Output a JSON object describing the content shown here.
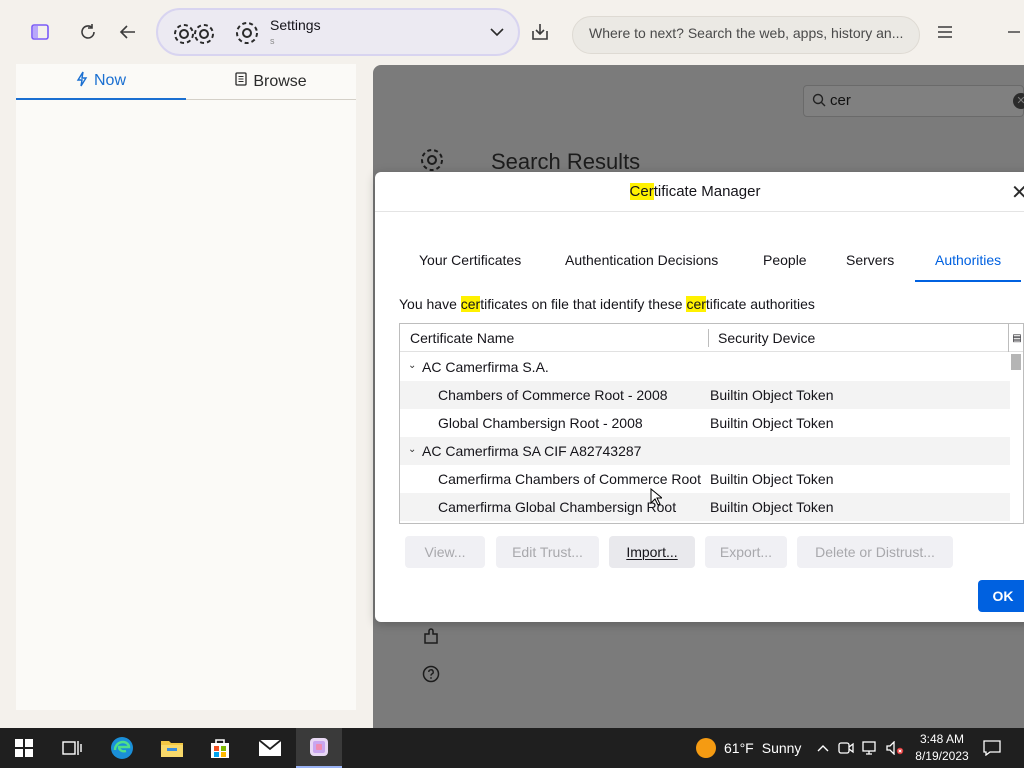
{
  "browser": {
    "url_title": "Settings",
    "url_subtitle": "s",
    "search_placeholder": "Where to next? Search the web, apps, history an..."
  },
  "sidebar": {
    "tabs": [
      {
        "label": "Now",
        "icon": "lightning-icon",
        "active": true
      },
      {
        "label": "Browse",
        "icon": "book-icon",
        "active": false
      }
    ]
  },
  "settings": {
    "find_value": "cer",
    "results_title": "Search Results"
  },
  "dialog": {
    "title_highlight": "Cer",
    "title_rest": "tificate Manager",
    "tabs": [
      {
        "label": "Your Certificates",
        "active": false
      },
      {
        "label": "Authentication Decisions",
        "active": false
      },
      {
        "label": "People",
        "active": false
      },
      {
        "label": "Servers",
        "active": false
      },
      {
        "label": "Authorities",
        "active": true
      }
    ],
    "desc_parts": [
      "You have ",
      "cer",
      "tificates on file that identify these ",
      "cer",
      "tificate authorities"
    ],
    "columns": [
      "Certificate Name",
      "Security Device"
    ],
    "rows": [
      {
        "type": "group",
        "name": "AC Camerfirma S.A.",
        "device": ""
      },
      {
        "type": "cert",
        "name": "Chambers of Commerce Root - 2008",
        "device": "Builtin Object Token"
      },
      {
        "type": "cert",
        "name": "Global Chambersign Root - 2008",
        "device": "Builtin Object Token"
      },
      {
        "type": "group",
        "name": "AC Camerfirma SA CIF A82743287",
        "device": ""
      },
      {
        "type": "cert",
        "name": "Camerfirma Chambers of Commerce Root",
        "device": "Builtin Object Token"
      },
      {
        "type": "cert",
        "name": "Camerfirma Global Chambersign Root",
        "device": "Builtin Object Token"
      }
    ],
    "buttons": {
      "view": "View...",
      "edit_trust": "Edit Trust...",
      "import": "Import...",
      "export": "Export...",
      "delete": "Delete or Distrust...",
      "ok": "OK"
    }
  },
  "taskbar": {
    "weather_temp": "61°F",
    "weather_text": "Sunny",
    "time": "3:48 AM",
    "date": "8/19/2023"
  },
  "colors": {
    "accent": "#0061e0",
    "sidebar_accent": "#1a6fd1",
    "highlight": "#fff100"
  }
}
